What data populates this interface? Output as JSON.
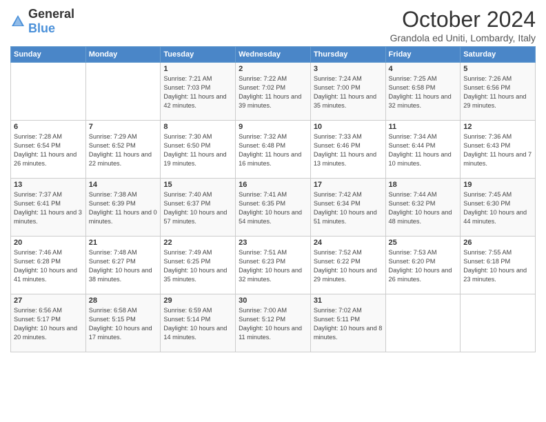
{
  "logo": {
    "general": "General",
    "blue": "Blue"
  },
  "header": {
    "month": "October 2024",
    "location": "Grandola ed Uniti, Lombardy, Italy"
  },
  "weekdays": [
    "Sunday",
    "Monday",
    "Tuesday",
    "Wednesday",
    "Thursday",
    "Friday",
    "Saturday"
  ],
  "weeks": [
    [
      {
        "day": null,
        "info": null
      },
      {
        "day": null,
        "info": null
      },
      {
        "day": "1",
        "info": "Sunrise: 7:21 AM\nSunset: 7:03 PM\nDaylight: 11 hours and 42 minutes."
      },
      {
        "day": "2",
        "info": "Sunrise: 7:22 AM\nSunset: 7:02 PM\nDaylight: 11 hours and 39 minutes."
      },
      {
        "day": "3",
        "info": "Sunrise: 7:24 AM\nSunset: 7:00 PM\nDaylight: 11 hours and 35 minutes."
      },
      {
        "day": "4",
        "info": "Sunrise: 7:25 AM\nSunset: 6:58 PM\nDaylight: 11 hours and 32 minutes."
      },
      {
        "day": "5",
        "info": "Sunrise: 7:26 AM\nSunset: 6:56 PM\nDaylight: 11 hours and 29 minutes."
      }
    ],
    [
      {
        "day": "6",
        "info": "Sunrise: 7:28 AM\nSunset: 6:54 PM\nDaylight: 11 hours and 26 minutes."
      },
      {
        "day": "7",
        "info": "Sunrise: 7:29 AM\nSunset: 6:52 PM\nDaylight: 11 hours and 22 minutes."
      },
      {
        "day": "8",
        "info": "Sunrise: 7:30 AM\nSunset: 6:50 PM\nDaylight: 11 hours and 19 minutes."
      },
      {
        "day": "9",
        "info": "Sunrise: 7:32 AM\nSunset: 6:48 PM\nDaylight: 11 hours and 16 minutes."
      },
      {
        "day": "10",
        "info": "Sunrise: 7:33 AM\nSunset: 6:46 PM\nDaylight: 11 hours and 13 minutes."
      },
      {
        "day": "11",
        "info": "Sunrise: 7:34 AM\nSunset: 6:44 PM\nDaylight: 11 hours and 10 minutes."
      },
      {
        "day": "12",
        "info": "Sunrise: 7:36 AM\nSunset: 6:43 PM\nDaylight: 11 hours and 7 minutes."
      }
    ],
    [
      {
        "day": "13",
        "info": "Sunrise: 7:37 AM\nSunset: 6:41 PM\nDaylight: 11 hours and 3 minutes."
      },
      {
        "day": "14",
        "info": "Sunrise: 7:38 AM\nSunset: 6:39 PM\nDaylight: 11 hours and 0 minutes."
      },
      {
        "day": "15",
        "info": "Sunrise: 7:40 AM\nSunset: 6:37 PM\nDaylight: 10 hours and 57 minutes."
      },
      {
        "day": "16",
        "info": "Sunrise: 7:41 AM\nSunset: 6:35 PM\nDaylight: 10 hours and 54 minutes."
      },
      {
        "day": "17",
        "info": "Sunrise: 7:42 AM\nSunset: 6:34 PM\nDaylight: 10 hours and 51 minutes."
      },
      {
        "day": "18",
        "info": "Sunrise: 7:44 AM\nSunset: 6:32 PM\nDaylight: 10 hours and 48 minutes."
      },
      {
        "day": "19",
        "info": "Sunrise: 7:45 AM\nSunset: 6:30 PM\nDaylight: 10 hours and 44 minutes."
      }
    ],
    [
      {
        "day": "20",
        "info": "Sunrise: 7:46 AM\nSunset: 6:28 PM\nDaylight: 10 hours and 41 minutes."
      },
      {
        "day": "21",
        "info": "Sunrise: 7:48 AM\nSunset: 6:27 PM\nDaylight: 10 hours and 38 minutes."
      },
      {
        "day": "22",
        "info": "Sunrise: 7:49 AM\nSunset: 6:25 PM\nDaylight: 10 hours and 35 minutes."
      },
      {
        "day": "23",
        "info": "Sunrise: 7:51 AM\nSunset: 6:23 PM\nDaylight: 10 hours and 32 minutes."
      },
      {
        "day": "24",
        "info": "Sunrise: 7:52 AM\nSunset: 6:22 PM\nDaylight: 10 hours and 29 minutes."
      },
      {
        "day": "25",
        "info": "Sunrise: 7:53 AM\nSunset: 6:20 PM\nDaylight: 10 hours and 26 minutes."
      },
      {
        "day": "26",
        "info": "Sunrise: 7:55 AM\nSunset: 6:18 PM\nDaylight: 10 hours and 23 minutes."
      }
    ],
    [
      {
        "day": "27",
        "info": "Sunrise: 6:56 AM\nSunset: 5:17 PM\nDaylight: 10 hours and 20 minutes."
      },
      {
        "day": "28",
        "info": "Sunrise: 6:58 AM\nSunset: 5:15 PM\nDaylight: 10 hours and 17 minutes."
      },
      {
        "day": "29",
        "info": "Sunrise: 6:59 AM\nSunset: 5:14 PM\nDaylight: 10 hours and 14 minutes."
      },
      {
        "day": "30",
        "info": "Sunrise: 7:00 AM\nSunset: 5:12 PM\nDaylight: 10 hours and 11 minutes."
      },
      {
        "day": "31",
        "info": "Sunrise: 7:02 AM\nSunset: 5:11 PM\nDaylight: 10 hours and 8 minutes."
      },
      {
        "day": null,
        "info": null
      },
      {
        "day": null,
        "info": null
      }
    ]
  ]
}
